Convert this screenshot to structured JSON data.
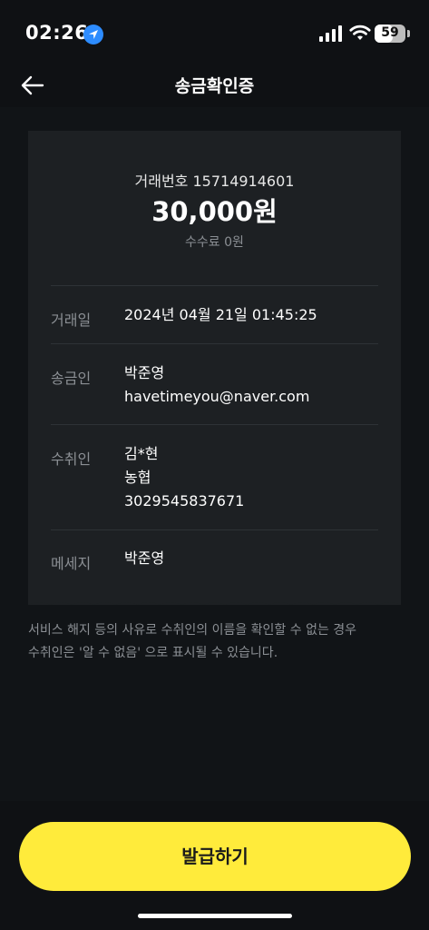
{
  "status_bar": {
    "time": "02:26",
    "battery": "59",
    "battery_level": 0.59
  },
  "header": {
    "title": "송금확인증"
  },
  "receipt": {
    "tx_number": "거래번호 15714914601",
    "amount": "30,000원",
    "fee": "수수료 0원",
    "rows": [
      {
        "label": "거래일",
        "values": [
          "2024년 04월 21일 01:45:25"
        ]
      },
      {
        "label": "송금인",
        "values": [
          "박준영",
          "havetimeyou@naver.com"
        ]
      },
      {
        "label": "수취인",
        "values": [
          "김*현",
          "농협",
          "3029545837671"
        ]
      },
      {
        "label": "메세지",
        "values": [
          "박준영"
        ]
      }
    ]
  },
  "notice": {
    "line1": "서비스 해지 등의 사유로 수취인의 이름을 확인할 수 없는 경우",
    "line2": "수취인은 '알 수 없음' 으로 표시될 수 있습니다."
  },
  "actions": {
    "issue_label": "발급하기"
  },
  "colors": {
    "accent": "#ffeb3b",
    "background": "#111417",
    "card": "#1d2023",
    "location": "#2d8cff"
  }
}
